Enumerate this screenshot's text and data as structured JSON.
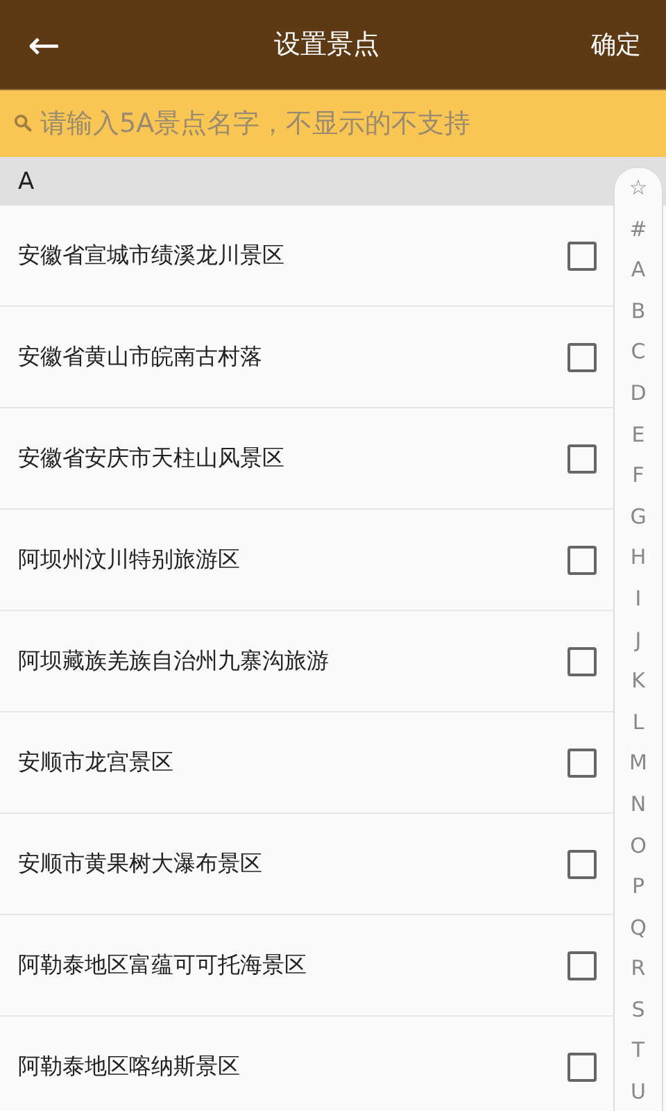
{
  "header": {
    "back": "←",
    "title": "设置景点",
    "confirm": "确定"
  },
  "search": {
    "placeholder": "请输入5A景点名字，不显示的不支持"
  },
  "section": "A",
  "rows": [
    {
      "name": "安徽省宣城市绩溪龙川景区",
      "checked": false
    },
    {
      "name": "安徽省黄山市皖南古村落",
      "checked": false
    },
    {
      "name": "安徽省安庆市天柱山风景区",
      "checked": false
    },
    {
      "name": "阿坝州汶川特别旅游区",
      "checked": false
    },
    {
      "name": "阿坝藏族羌族自治州九寨沟旅游",
      "checked": false
    },
    {
      "name": "安顺市龙宫景区",
      "checked": false
    },
    {
      "name": "安顺市黄果树大瀑布景区",
      "checked": false
    },
    {
      "name": "阿勒泰地区富蕴可可托海景区",
      "checked": false
    },
    {
      "name": "阿勒泰地区喀纳斯景区",
      "checked": false
    }
  ],
  "index": [
    "☆",
    "#",
    "A",
    "B",
    "C",
    "D",
    "E",
    "F",
    "G",
    "H",
    "I",
    "J",
    "K",
    "L",
    "M",
    "N",
    "O",
    "P",
    "Q",
    "R",
    "S",
    "T",
    "U"
  ]
}
